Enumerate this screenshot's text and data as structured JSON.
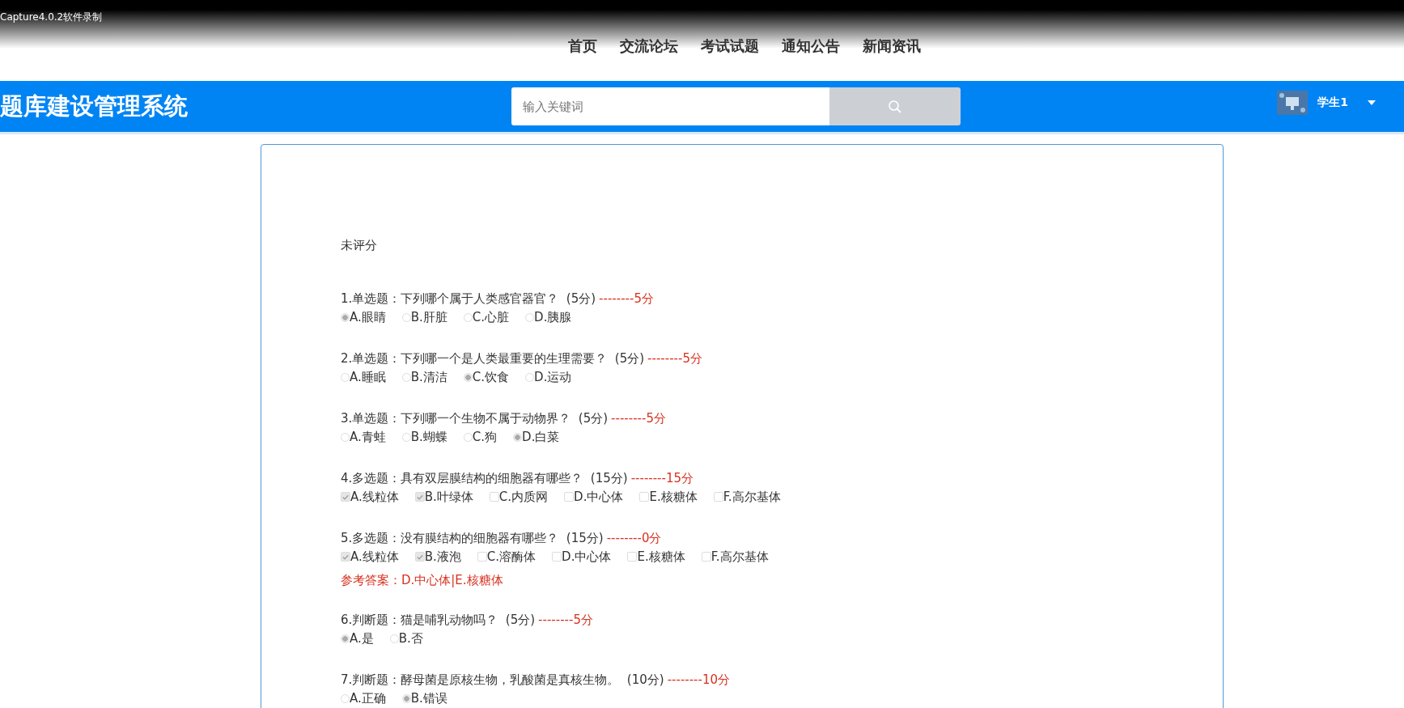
{
  "recorder_label": "Capture4.0.2软件录制",
  "nav": [
    {
      "label": "首页"
    },
    {
      "label": "交流论坛"
    },
    {
      "label": "考试试题"
    },
    {
      "label": "通知公告"
    },
    {
      "label": "新闻资讯"
    }
  ],
  "header": {
    "title": "题库建设管理系统",
    "search": {
      "placeholder": "输入关键词"
    },
    "user": {
      "name": "学生1"
    }
  },
  "status": "未评分",
  "questions": [
    {
      "number": "1.",
      "type": "单选题：",
      "text": "下列哪个属于人类感官器官？",
      "points": "(5分)",
      "score": "--------5分",
      "kind": "radio",
      "options": [
        {
          "label": "A.眼睛",
          "selected": true
        },
        {
          "label": "B.肝脏",
          "selected": false
        },
        {
          "label": "C.心脏",
          "selected": false
        },
        {
          "label": "D.胰腺",
          "selected": false
        }
      ]
    },
    {
      "number": "2.",
      "type": "单选题：",
      "text": "下列哪一个是人类最重要的生理需要？",
      "points": "(5分)",
      "score": "--------5分",
      "kind": "radio",
      "options": [
        {
          "label": "A.睡眠",
          "selected": false
        },
        {
          "label": "B.清洁",
          "selected": false
        },
        {
          "label": "C.饮食",
          "selected": true
        },
        {
          "label": "D.运动",
          "selected": false
        }
      ]
    },
    {
      "number": "3.",
      "type": "单选题：",
      "text": "下列哪一个生物不属于动物界？",
      "points": "(5分)",
      "score": "--------5分",
      "kind": "radio",
      "options": [
        {
          "label": "A.青蛙",
          "selected": false
        },
        {
          "label": "B.蝴蝶",
          "selected": false
        },
        {
          "label": "C.狗",
          "selected": false
        },
        {
          "label": "D.白菜",
          "selected": true
        }
      ]
    },
    {
      "number": "4.",
      "type": "多选题：",
      "text": "具有双层膜结构的细胞器有哪些？",
      "points": "(15分)",
      "score": "--------15分",
      "kind": "checkbox",
      "options": [
        {
          "label": "A.线粒体",
          "selected": true
        },
        {
          "label": "B.叶绿体",
          "selected": true
        },
        {
          "label": "C.内质网",
          "selected": false
        },
        {
          "label": "D.中心体",
          "selected": false
        },
        {
          "label": "E.核糖体",
          "selected": false
        },
        {
          "label": "F.高尔基体",
          "selected": false
        }
      ]
    },
    {
      "number": "5.",
      "type": "多选题：",
      "text": "没有膜结构的细胞器有哪些？",
      "points": "(15分)",
      "score": "--------0分",
      "kind": "checkbox",
      "options": [
        {
          "label": "A.线粒体",
          "selected": true
        },
        {
          "label": "B.液泡",
          "selected": true
        },
        {
          "label": "C.溶酶体",
          "selected": false
        },
        {
          "label": "D.中心体",
          "selected": false
        },
        {
          "label": "E.核糖体",
          "selected": false
        },
        {
          "label": "F.高尔基体",
          "selected": false
        }
      ],
      "answer": "参考答案：D.中心体|E.核糖体"
    },
    {
      "number": "6.",
      "type": "判断题：",
      "text": "猫是哺乳动物吗？",
      "points": "(5分)",
      "score": "--------5分",
      "kind": "radio",
      "options": [
        {
          "label": "A.是",
          "selected": true
        },
        {
          "label": "B.否",
          "selected": false
        }
      ]
    },
    {
      "number": "7.",
      "type": "判断题：",
      "text": "酵母菌是原核生物，乳酸菌是真核生物。",
      "points": "(10分)",
      "score": "--------10分",
      "kind": "radio",
      "options": [
        {
          "label": "A.正确",
          "selected": false
        },
        {
          "label": "B.错误",
          "selected": true
        }
      ]
    }
  ]
}
